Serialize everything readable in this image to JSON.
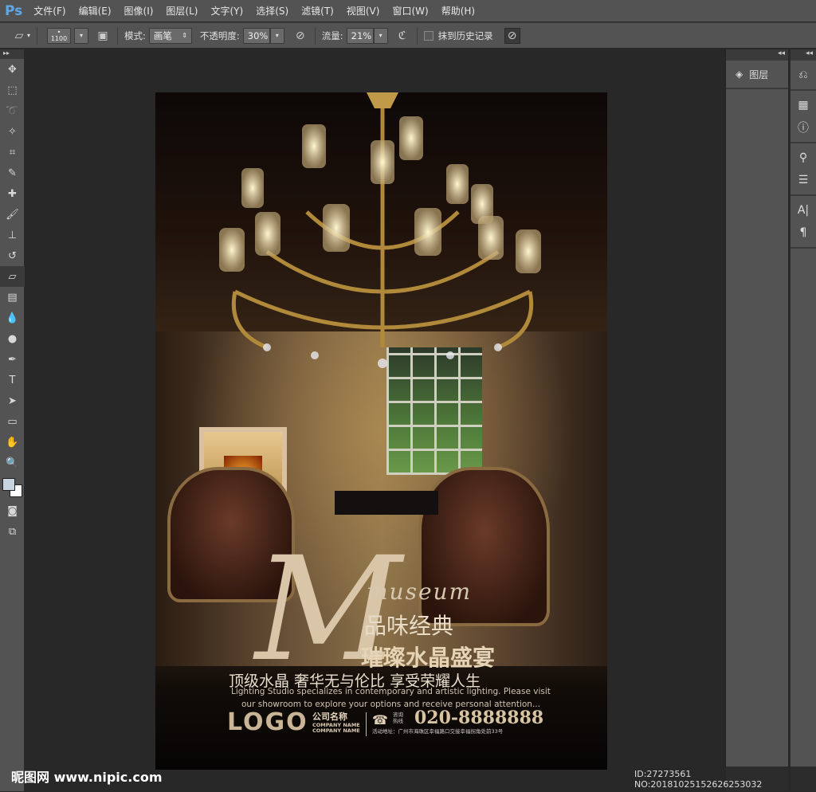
{
  "app": {
    "logo": "Ps"
  },
  "menu": [
    "文件(F)",
    "编辑(E)",
    "图像(I)",
    "图层(L)",
    "文字(Y)",
    "选择(S)",
    "滤镜(T)",
    "视图(V)",
    "窗口(W)",
    "帮助(H)"
  ],
  "options": {
    "brush_size": "1100",
    "mode_label": "模式:",
    "mode_value": "画笔",
    "opacity_label": "不透明度:",
    "opacity_value": "30%",
    "flow_label": "流量:",
    "flow_value": "21%",
    "history_label": "抹到历史记录",
    "history_checked": false
  },
  "tools": [
    "move-icon",
    "marquee-icon",
    "lasso-icon",
    "magic-wand-icon",
    "crop-icon",
    "eyedropper-icon",
    "healing-icon",
    "brush-icon",
    "stamp-icon",
    "history-brush-icon",
    "eraser-icon",
    "gradient-icon",
    "blur-icon",
    "dodge-icon",
    "pen-icon",
    "type-icon",
    "path-select-icon",
    "shape-icon",
    "hand-icon",
    "zoom-icon"
  ],
  "panels": {
    "layers_label": "图层",
    "collapse": "◂◂"
  },
  "poster": {
    "big_letter": "M",
    "museum": "museum",
    "title1": "品味经典",
    "title2": "璀璨水晶盛宴",
    "slogan": "顶级水晶 奢华无与伦比 享受荣耀人生",
    "desc1": "Lighting Studio specializes in contemporary and artistic lighting. Please visit",
    "desc2": "our showroom to explore your options and receive personal attention...",
    "logo": "LOGO",
    "company_cn": "公司名称",
    "company_en1": "COMPANY NAME",
    "company_en2": "COMPANY NAME",
    "hotline": "咨询热线",
    "phone": "020-8888888",
    "address": "活动地址：广州市海珠区幸福路口交接幸福拐角处前33号"
  },
  "watermark": {
    "site": "昵图网 www.nipic.com",
    "id": "ID:27273561 NO:20181025152626253032"
  }
}
